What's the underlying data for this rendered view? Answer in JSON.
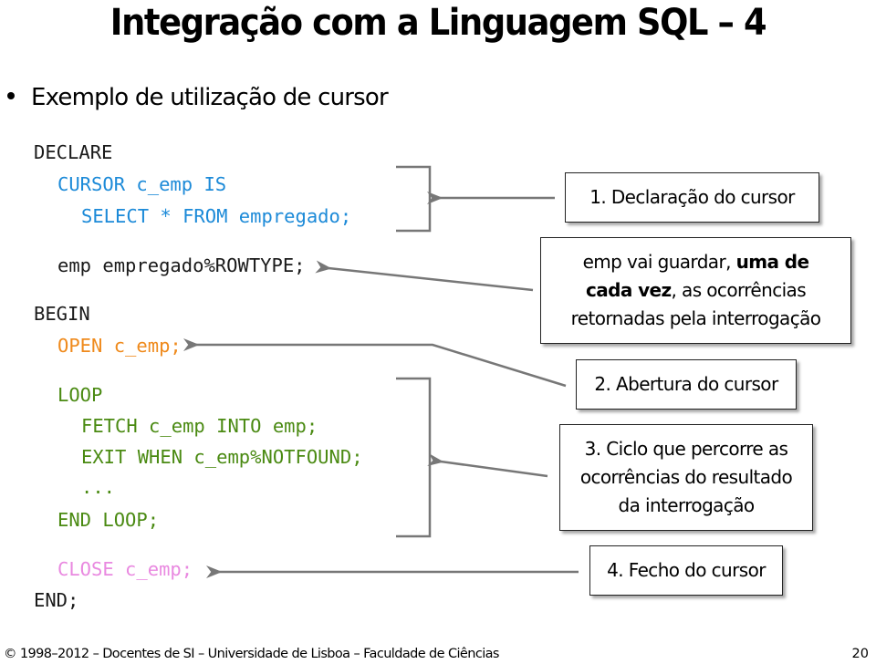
{
  "slide": {
    "title": "Integração com a Linguagem SQL – 4",
    "bullet": "Exemplo de utilização de cursor"
  },
  "code": {
    "declare": "DECLARE",
    "cursor_line": "CURSOR c_emp IS",
    "select_line": "SELECT * FROM empregado;",
    "emp_line": "emp empregado%ROWTYPE;",
    "begin": "BEGIN",
    "open_line": "OPEN c_emp;",
    "loop": "LOOP",
    "fetch_line": "FETCH c_emp INTO emp;",
    "exit_line": "EXIT WHEN c_emp%NOTFOUND;",
    "ellipsis": "...",
    "end_loop": "END LOOP;",
    "close_line": "CLOSE c_emp;",
    "end": "END;"
  },
  "colors": {
    "declaration": "#1c8ad8",
    "open": "#ef8a1c",
    "loop": "#4a8a12",
    "close": "#e989e0",
    "connector": "#777777"
  },
  "callouts": {
    "declaration": "1. Declaração do cursor",
    "emp_note": {
      "part1": "emp vai guardar, ",
      "bold": "uma de cada vez",
      "part2": ", as ocorrências retornadas pela interrogação"
    },
    "opening": "2. Abertura do cursor",
    "loop": "3. Ciclo que percorre as ocorrências do resultado da interrogação",
    "closing": "4. Fecho do cursor"
  },
  "footer": {
    "copyright": "© 1998–2012 – Docentes de SI – Universidade de Lisboa – Faculdade de Ciências",
    "page_number": "20"
  }
}
